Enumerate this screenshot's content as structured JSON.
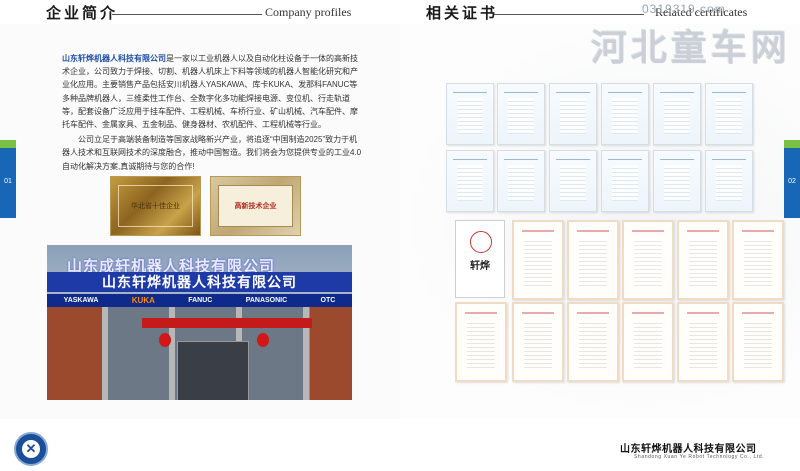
{
  "header": {
    "left_cn": "企业简介",
    "left_en": "Company profiles",
    "right_cn": "相关证书",
    "right_en": "Related certificates"
  },
  "watermark": {
    "site": "0319319.com",
    "name": "河北童车网"
  },
  "intro": {
    "company": "山东轩烨机器人科技有限公司",
    "p1_rest": "是一家以工业机器人以及自动化柱设备于一体的高新技术企业，公司致力于焊接、切割、机器人机床上下料等领域的机器人智能化研究和产业化应用。主要销售产品包括安川机器人YASKAWA、库卡KUKA、发那科FANUC等多种品牌机器人，三维柔性工作台、全数字化多功能焊接电源、变位机、行走轨道等，配套设备广泛应用于挂车配件、工程机械、车桥行业、矿山机械、汽车配件、摩托车配件、金属家具、五金制品、健身器材、农机配件、工程机械等行业。",
    "p2": "公司立足于高端装备制造等国家战略新兴产业，将追逐“中国制造2025”致力于机器人技术和互联网技术的深度融合，推动中国智造。我们将会为您提供专业的工业4.0自动化解决方案,真诚期待与您的合作!"
  },
  "plaques": {
    "p1": "华北省十佳企业",
    "p2": "高新技术企业"
  },
  "photo": {
    "sign_top": "山东成轩机器人科技有限公司",
    "sign_main": "山东轩烨机器人科技有限公司",
    "brands": [
      "YASKAWA",
      "KUKA",
      "FANUC",
      "PANASONIC",
      "OTC"
    ]
  },
  "certificate_special": {
    "label": "轩烨"
  },
  "pages": {
    "left": "01",
    "right": "02"
  },
  "footer": {
    "company_cn": "山东轩烨机器人科技有限公司",
    "company_en": "Shandong Xuan Ye Robot Technology Co., Ltd."
  },
  "colors": {
    "accent_blue": "#1767b6",
    "accent_green": "#7bc143",
    "company_blue": "#1f4fa8"
  }
}
